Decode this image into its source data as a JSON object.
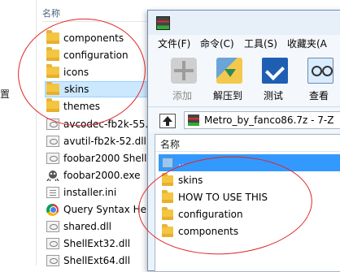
{
  "explorer": {
    "column_header": "名称",
    "side_fragment": "置",
    "items": [
      {
        "name": "components",
        "type": "folder"
      },
      {
        "name": "configuration",
        "type": "folder"
      },
      {
        "name": "icons",
        "type": "folder"
      },
      {
        "name": "skins",
        "type": "folder",
        "selected": true
      },
      {
        "name": "themes",
        "type": "folder"
      },
      {
        "name": "avcodec-fb2k-55.",
        "type": "dll"
      },
      {
        "name": "avutil-fb2k-52.dll",
        "type": "dll"
      },
      {
        "name": "foobar2000 Shell",
        "type": "dll"
      },
      {
        "name": "foobar2000.exe",
        "type": "exe"
      },
      {
        "name": "installer.ini",
        "type": "ini"
      },
      {
        "name": "Query Syntax Help",
        "type": "chrome"
      },
      {
        "name": "shared.dll",
        "type": "dll"
      },
      {
        "name": "ShellExt32.dll",
        "type": "dll"
      },
      {
        "name": "ShellExt64.dll",
        "type": "dll"
      }
    ]
  },
  "sevenzip": {
    "menu": [
      "文件(F)",
      "命令(C)",
      "工具(S)",
      "收藏夹(A"
    ],
    "toolbar": [
      {
        "label": "添加",
        "icon": "add-icon",
        "disabled": true
      },
      {
        "label": "解压到",
        "icon": "extract-icon"
      },
      {
        "label": "测试",
        "icon": "test-icon"
      },
      {
        "label": "查看",
        "icon": "view-icon"
      }
    ],
    "path": "Metro_by_fanco86.7z - 7-Z",
    "column_header": "名称",
    "items": [
      {
        "name": "..",
        "type": "parent",
        "selected": true
      },
      {
        "name": "skins",
        "type": "folder"
      },
      {
        "name": "HOW TO USE THIS",
        "type": "folder"
      },
      {
        "name": "configuration",
        "type": "folder"
      },
      {
        "name": "components",
        "type": "folder"
      }
    ]
  },
  "colors": {
    "annotation": "#e32424",
    "selection_light": "#cce8ff",
    "selection_strong": "#3399ff",
    "folder": "#f4c542"
  }
}
